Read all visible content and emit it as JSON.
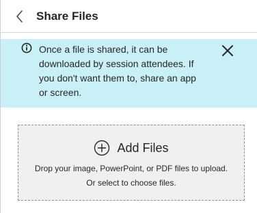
{
  "header": {
    "title": "Share Files",
    "back_icon": "chevron-left-icon"
  },
  "notice": {
    "icon": "info-icon",
    "lines": [
      "Once a file is shared, it can be",
      "downloaded by session attendees. If",
      "you don't want them to, share an app",
      "or screen."
    ],
    "close_icon": "close-icon",
    "background_color": "#c9f0f6"
  },
  "dropzone": {
    "icon": "plus-circle-icon",
    "add_label": "Add Files",
    "hint_line_1": "Drop your image, PowerPoint, or PDF files to upload.",
    "hint_line_2": "Or select to choose files."
  }
}
